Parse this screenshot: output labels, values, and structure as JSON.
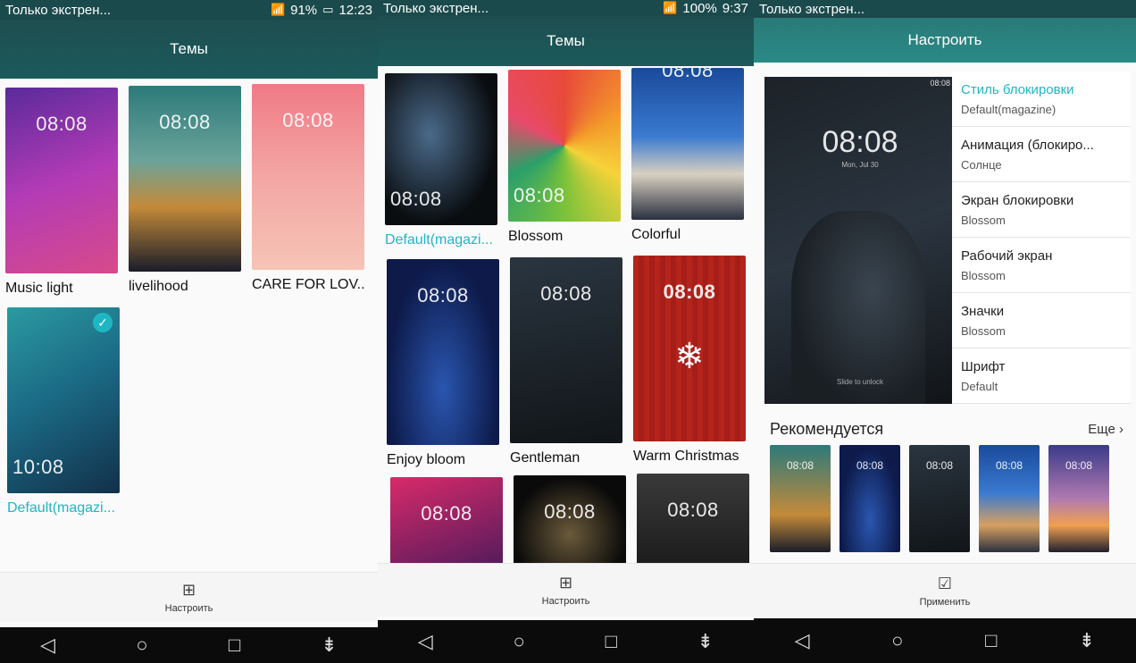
{
  "panel1": {
    "status": {
      "carrier": "Только экстрен...",
      "battery": "91%",
      "time": "12:23"
    },
    "title": "Темы",
    "themes": [
      {
        "name": "Music light",
        "clock": "08:08",
        "active": false
      },
      {
        "name": "livelihood",
        "clock": "08:08",
        "active": false
      },
      {
        "name": "CARE FOR LOV...",
        "clock": "08:08",
        "active": false
      },
      {
        "name": "Default(magazi...",
        "clock": "10:08",
        "active": true
      }
    ],
    "action_label": "Настроить"
  },
  "panel2": {
    "status": {
      "carrier": "Только экстрен...",
      "battery": "100%",
      "time": "9:37"
    },
    "title": "Темы",
    "themes": [
      {
        "name": "Default(magazi...",
        "clock": "08:08",
        "active": true
      },
      {
        "name": "Blossom",
        "clock": "08:08",
        "active": false
      },
      {
        "name": "Colorful",
        "clock": "08:08",
        "active": false
      },
      {
        "name": "Enjoy bloom",
        "clock": "08:08",
        "active": false
      },
      {
        "name": "Gentleman",
        "clock": "08:08",
        "active": false
      },
      {
        "name": "Warm Christmas",
        "clock": "08:08",
        "active": false
      },
      {
        "name": "",
        "clock": "08:08",
        "active": false
      },
      {
        "name": "",
        "clock": "08:08",
        "active": false
      },
      {
        "name": "",
        "clock": "08:08",
        "active": false
      }
    ],
    "action_label": "Настроить"
  },
  "panel3": {
    "status": {
      "carrier": "Только экстрен..."
    },
    "title": "Настроить",
    "preview": {
      "clock": "08:08",
      "date": "Mon, Jul 30",
      "unlock": "Slide to unlock",
      "status_time": "08:08"
    },
    "settings": [
      {
        "title": "Стиль блокировки",
        "value": "Default(magazine)",
        "selected": true
      },
      {
        "title": "Анимация (блокиро...",
        "value": "Солнце",
        "selected": false
      },
      {
        "title": "Экран блокировки",
        "value": "Blossom",
        "selected": false
      },
      {
        "title": "Рабочий экран",
        "value": "Blossom",
        "selected": false
      },
      {
        "title": "Значки",
        "value": "Blossom",
        "selected": false
      },
      {
        "title": "Шрифт",
        "value": "Default",
        "selected": false
      }
    ],
    "recommended_title": "Рекомендуется",
    "recommended_more": "Еще",
    "recommended_clock": "08:08",
    "action_label": "Применить"
  },
  "accent": "#1fb6c3"
}
